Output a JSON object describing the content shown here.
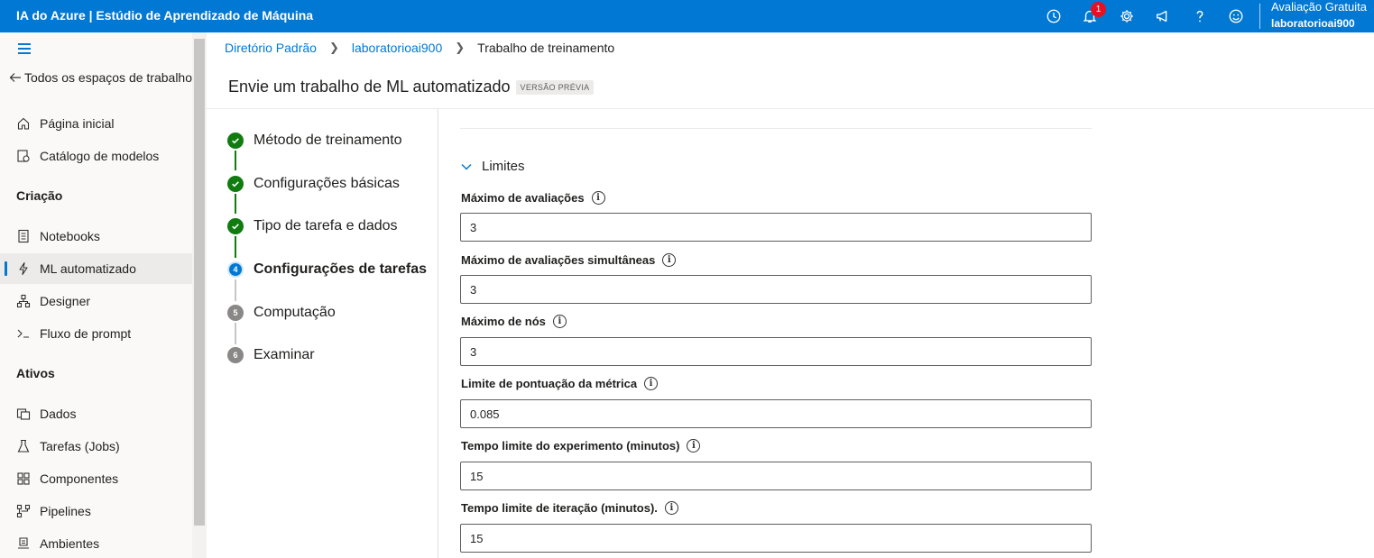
{
  "app": {
    "title": "IA do Azure | Estúdio de Aprendizado de Máquina"
  },
  "topbar": {
    "icons": [
      "clock-icon",
      "bell-icon",
      "gear-icon",
      "megaphone-icon",
      "help-icon",
      "smiley-icon"
    ],
    "notification_count": "1",
    "account_plan": "Avaliação Gratuita",
    "account_workspace": "laboratorioai900"
  },
  "sidebar": {
    "back_label": "Todos os espaços de trabalho",
    "home": "Página inicial",
    "model_catalog": "Catálogo de modelos",
    "section_authoring": "Criação",
    "notebooks": "Notebooks",
    "automl": "ML automatizado",
    "designer": "Designer",
    "prompt_flow": "Fluxo de prompt",
    "section_assets": "Ativos",
    "data": "Dados",
    "jobs": "Tarefas (Jobs)",
    "components": "Componentes",
    "pipelines": "Pipelines",
    "environments": "Ambientes"
  },
  "breadcrumb": {
    "item1": "Diretório Padrão",
    "item2": "laboratorioai900",
    "current": "Trabalho de treinamento"
  },
  "page": {
    "title": "Envie um trabalho de ML automatizado",
    "preview_tag": "VERSÃO PRÉVIA"
  },
  "steps": [
    {
      "label": "Método de treinamento",
      "status": "done"
    },
    {
      "label": "Configurações básicas",
      "status": "done"
    },
    {
      "label": "Tipo de tarefa e dados",
      "status": "done"
    },
    {
      "label": "Configurações de tarefas",
      "status": "current",
      "number": "4"
    },
    {
      "label": "Computação",
      "status": "todo",
      "number": "5"
    },
    {
      "label": "Examinar",
      "status": "todo",
      "number": "6"
    }
  ],
  "limits": {
    "section_title": "Limites",
    "max_trials_label": "Máximo de avaliações",
    "max_trials_value": "3",
    "max_concurrent_label": "Máximo de avaliações simultâneas",
    "max_concurrent_value": "3",
    "max_nodes_label": "Máximo de nós",
    "max_nodes_value": "3",
    "metric_threshold_label": "Limite de pontuação da métrica",
    "metric_threshold_value": "0.085",
    "experiment_timeout_label": "Tempo limite do experimento (minutos)",
    "experiment_timeout_value": "15",
    "iteration_timeout_label": "Tempo limite de iteração (minutos).",
    "iteration_timeout_value": "15"
  },
  "colors": {
    "brand": "#0078d4",
    "success": "#107c10",
    "badge": "#e81123"
  }
}
